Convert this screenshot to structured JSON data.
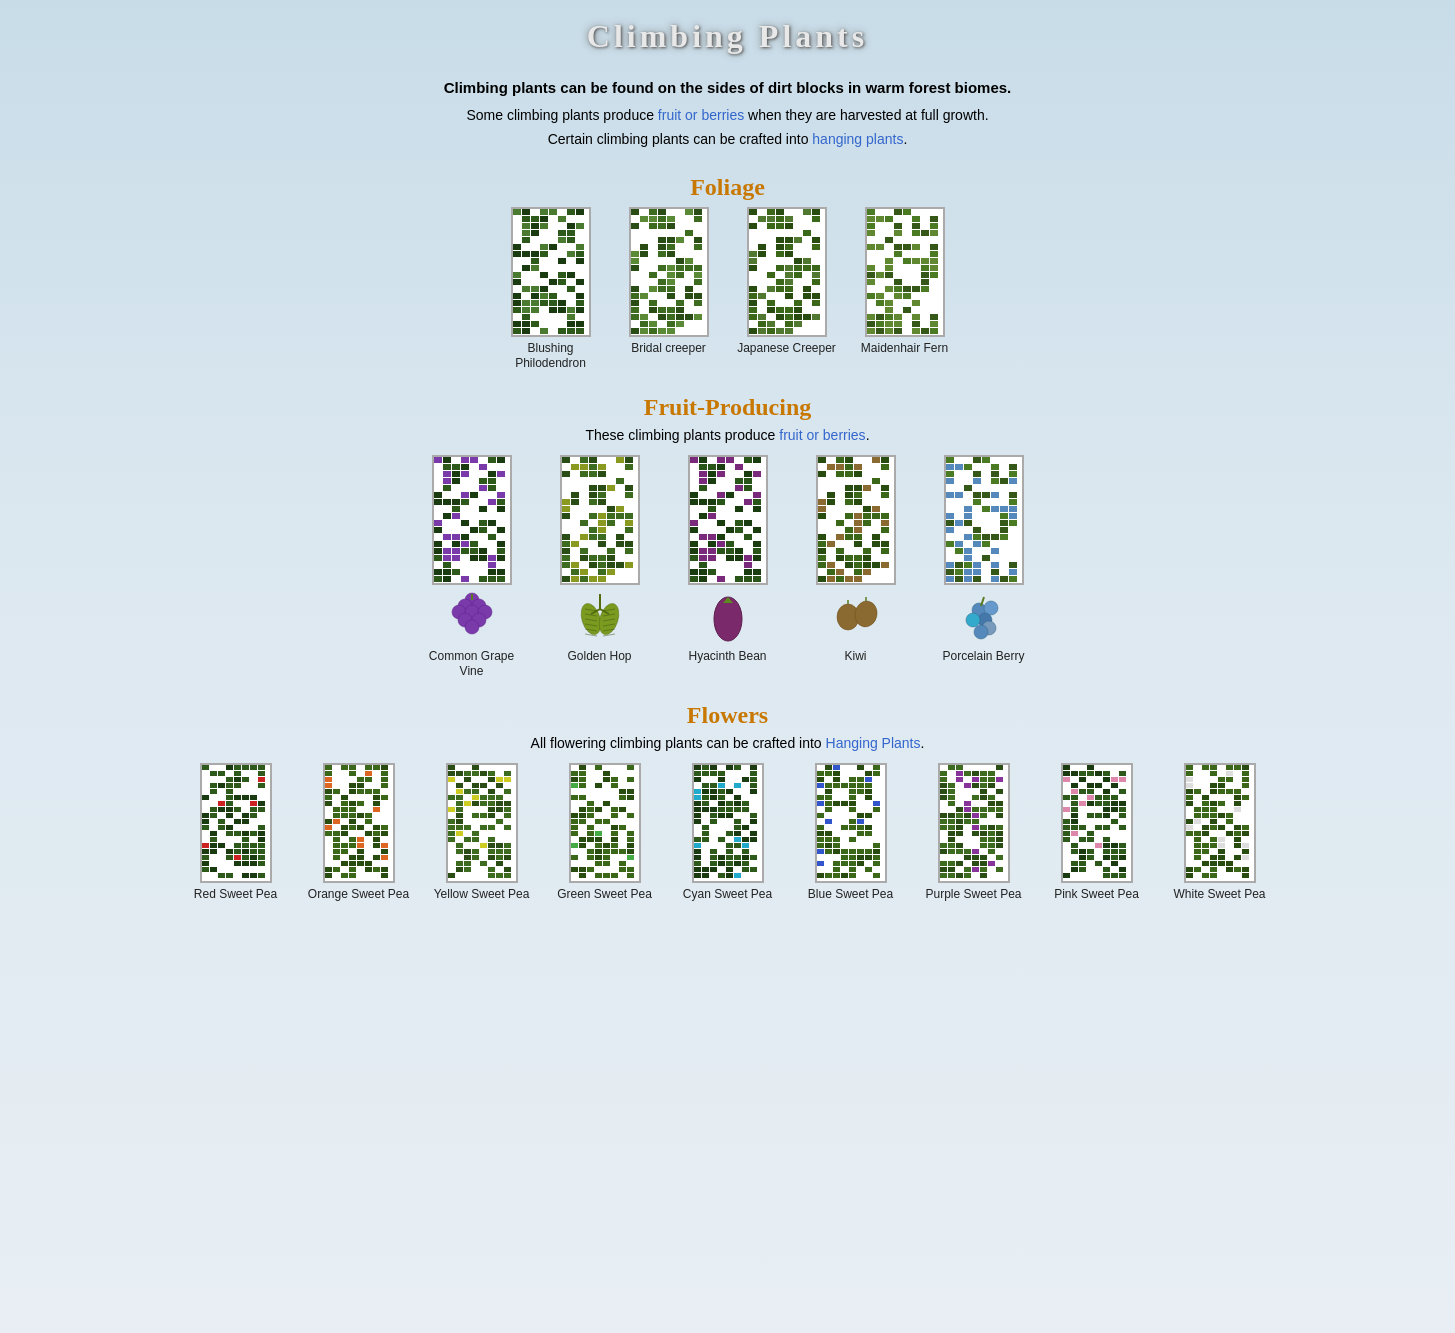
{
  "page": {
    "title": "Climbing Plants",
    "intro_bold": "Climbing plants can be found on the sides of dirt blocks in warm forest biomes.",
    "intro_line1": "Some climbing plants produce ",
    "intro_link1": "fruit or berries",
    "intro_line1b": " when they are harvested at full growth.",
    "intro_line2": "Certain climbing plants can be crafted into ",
    "intro_link2": "hanging plants",
    "intro_line2b": "."
  },
  "foliage": {
    "title": "Foliage",
    "plants": [
      {
        "label": "Blushing\nPhilodendron",
        "color1": "#2d5a1b",
        "color2": "#1a3a10",
        "accent": "#4a7a30"
      },
      {
        "label": "Bridal\ncreeper",
        "color1": "#3d6b20",
        "color2": "#2a4d15",
        "accent": "#5a8a35"
      },
      {
        "label": "Japanese\nCreeper",
        "color1": "#3a6818",
        "color2": "#284c10",
        "accent": "#507830"
      },
      {
        "label": "Maidenhair\nFern",
        "color1": "#4a7a22",
        "color2": "#355818",
        "accent": "#608830"
      }
    ]
  },
  "fruit_producing": {
    "title": "Fruit-Producing",
    "subtitle": "These climbing plants produce ",
    "subtitle_link": "fruit or berries",
    "subtitle_end": ".",
    "plants": [
      {
        "label": "Common\nGrape Vine",
        "color1": "#2d5a1b",
        "color2": "#1a3a10",
        "accent": "#7a3aaa",
        "fruit_type": "grapes"
      },
      {
        "label": "Golden\nHop",
        "color1": "#3d6b20",
        "color2": "#2a4d15",
        "accent": "#8a9a20",
        "fruit_type": "hops"
      },
      {
        "label": "Hyacinth\nBean",
        "color1": "#2a5518",
        "color2": "#1a3d10",
        "accent": "#7a2a7a",
        "fruit_type": "pod"
      },
      {
        "label": "Kiwi",
        "color1": "#3a6818",
        "color2": "#284c10",
        "accent": "#8a6a30",
        "fruit_type": "kiwi"
      },
      {
        "label": "Porcelain\nBerry",
        "color1": "#4a7a22",
        "color2": "#355818",
        "accent": "#5588bb",
        "fruit_type": "porcelain"
      }
    ]
  },
  "flowers": {
    "title": "Flowers",
    "subtitle": "All flowering climbing plants can be crafted into ",
    "subtitle_link": "Hanging Plants",
    "subtitle_end": ".",
    "plants": [
      {
        "label": "Red\nSweet Pea",
        "color1": "#2d5a1b",
        "color2": "#1a3a10",
        "flower": "#cc2222"
      },
      {
        "label": "Orange\nSweet Pea",
        "color1": "#3a6818",
        "color2": "#284c10",
        "flower": "#dd6622"
      },
      {
        "label": "Yellow\nSweet Pea",
        "color1": "#3d6b20",
        "color2": "#2a4d15",
        "flower": "#cccc22"
      },
      {
        "label": "Green\nSweet Pea",
        "color1": "#3a6818",
        "color2": "#284c10",
        "flower": "#44aa44"
      },
      {
        "label": "Cyan\nSweet Pea",
        "color1": "#2d5a1b",
        "color2": "#1a3a10",
        "flower": "#22aacc"
      },
      {
        "label": "Blue\nSweet Pea",
        "color1": "#3a6818",
        "color2": "#284c10",
        "flower": "#3355cc"
      },
      {
        "label": "Purple\nSweet Pea",
        "color1": "#3d6b20",
        "color2": "#2a4d15",
        "flower": "#883399"
      },
      {
        "label": "Pink\nSweet Pea",
        "color1": "#2d5a1b",
        "color2": "#1a3a10",
        "flower": "#dd88aa"
      },
      {
        "label": "White\nSweet Pea",
        "color1": "#3a6818",
        "color2": "#284c10",
        "flower": "#dddddd"
      }
    ]
  }
}
